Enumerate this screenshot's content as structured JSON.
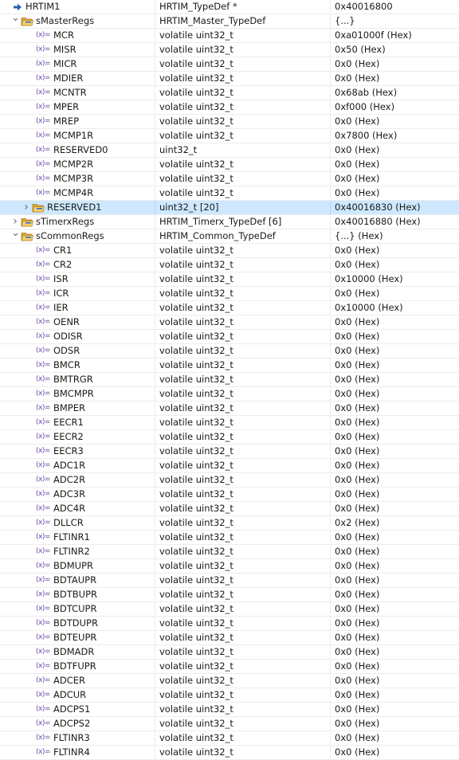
{
  "rows": [
    {
      "level": 0,
      "expander": "none",
      "icon": "pointer",
      "name": "HRTIM1",
      "type": "HRTIM_TypeDef *",
      "value": "0x40016800"
    },
    {
      "level": 1,
      "expander": "expanded",
      "icon": "struct",
      "name": "sMasterRegs",
      "type": "HRTIM_Master_TypeDef",
      "value": "{...}"
    },
    {
      "level": 2,
      "expander": "none",
      "icon": "variable",
      "name": "MCR",
      "type": "volatile uint32_t",
      "value": "0xa01000f (Hex)"
    },
    {
      "level": 2,
      "expander": "none",
      "icon": "variable",
      "name": "MISR",
      "type": "volatile uint32_t",
      "value": "0x50 (Hex)"
    },
    {
      "level": 2,
      "expander": "none",
      "icon": "variable",
      "name": "MICR",
      "type": "volatile uint32_t",
      "value": "0x0 (Hex)"
    },
    {
      "level": 2,
      "expander": "none",
      "icon": "variable",
      "name": "MDIER",
      "type": "volatile uint32_t",
      "value": "0x0 (Hex)"
    },
    {
      "level": 2,
      "expander": "none",
      "icon": "variable",
      "name": "MCNTR",
      "type": "volatile uint32_t",
      "value": "0x68ab (Hex)"
    },
    {
      "level": 2,
      "expander": "none",
      "icon": "variable",
      "name": "MPER",
      "type": "volatile uint32_t",
      "value": "0xf000 (Hex)"
    },
    {
      "level": 2,
      "expander": "none",
      "icon": "variable",
      "name": "MREP",
      "type": "volatile uint32_t",
      "value": "0x0 (Hex)"
    },
    {
      "level": 2,
      "expander": "none",
      "icon": "variable",
      "name": "MCMP1R",
      "type": "volatile uint32_t",
      "value": "0x7800 (Hex)"
    },
    {
      "level": 2,
      "expander": "none",
      "icon": "variable",
      "name": "RESERVED0",
      "type": "uint32_t",
      "value": "0x0 (Hex)"
    },
    {
      "level": 2,
      "expander": "none",
      "icon": "variable",
      "name": "MCMP2R",
      "type": "volatile uint32_t",
      "value": "0x0 (Hex)"
    },
    {
      "level": 2,
      "expander": "none",
      "icon": "variable",
      "name": "MCMP3R",
      "type": "volatile uint32_t",
      "value": "0x0 (Hex)"
    },
    {
      "level": 2,
      "expander": "none",
      "icon": "variable",
      "name": "MCMP4R",
      "type": "volatile uint32_t",
      "value": "0x0 (Hex)"
    },
    {
      "level": 2,
      "expander": "collapsed",
      "icon": "struct",
      "name": "RESERVED1",
      "type": "uint32_t [20]",
      "value": "0x40016830 (Hex)",
      "selected": true
    },
    {
      "level": 1,
      "expander": "collapsed",
      "icon": "struct",
      "name": "sTimerxRegs",
      "type": "HRTIM_Timerx_TypeDef [6]",
      "value": "0x40016880 (Hex)"
    },
    {
      "level": 1,
      "expander": "expanded",
      "icon": "struct",
      "name": "sCommonRegs",
      "type": "HRTIM_Common_TypeDef",
      "value": "{...} (Hex)"
    },
    {
      "level": 2,
      "expander": "none",
      "icon": "variable",
      "name": "CR1",
      "type": "volatile uint32_t",
      "value": "0x0 (Hex)"
    },
    {
      "level": 2,
      "expander": "none",
      "icon": "variable",
      "name": "CR2",
      "type": "volatile uint32_t",
      "value": "0x0 (Hex)"
    },
    {
      "level": 2,
      "expander": "none",
      "icon": "variable",
      "name": "ISR",
      "type": "volatile uint32_t",
      "value": "0x10000 (Hex)"
    },
    {
      "level": 2,
      "expander": "none",
      "icon": "variable",
      "name": "ICR",
      "type": "volatile uint32_t",
      "value": "0x0 (Hex)"
    },
    {
      "level": 2,
      "expander": "none",
      "icon": "variable",
      "name": "IER",
      "type": "volatile uint32_t",
      "value": "0x10000 (Hex)"
    },
    {
      "level": 2,
      "expander": "none",
      "icon": "variable",
      "name": "OENR",
      "type": "volatile uint32_t",
      "value": "0x0 (Hex)"
    },
    {
      "level": 2,
      "expander": "none",
      "icon": "variable",
      "name": "ODISR",
      "type": "volatile uint32_t",
      "value": "0x0 (Hex)"
    },
    {
      "level": 2,
      "expander": "none",
      "icon": "variable",
      "name": "ODSR",
      "type": "volatile uint32_t",
      "value": "0x0 (Hex)"
    },
    {
      "level": 2,
      "expander": "none",
      "icon": "variable",
      "name": "BMCR",
      "type": "volatile uint32_t",
      "value": "0x0 (Hex)"
    },
    {
      "level": 2,
      "expander": "none",
      "icon": "variable",
      "name": "BMTRGR",
      "type": "volatile uint32_t",
      "value": "0x0 (Hex)"
    },
    {
      "level": 2,
      "expander": "none",
      "icon": "variable",
      "name": "BMCMPR",
      "type": "volatile uint32_t",
      "value": "0x0 (Hex)"
    },
    {
      "level": 2,
      "expander": "none",
      "icon": "variable",
      "name": "BMPER",
      "type": "volatile uint32_t",
      "value": "0x0 (Hex)"
    },
    {
      "level": 2,
      "expander": "none",
      "icon": "variable",
      "name": "EECR1",
      "type": "volatile uint32_t",
      "value": "0x0 (Hex)"
    },
    {
      "level": 2,
      "expander": "none",
      "icon": "variable",
      "name": "EECR2",
      "type": "volatile uint32_t",
      "value": "0x0 (Hex)"
    },
    {
      "level": 2,
      "expander": "none",
      "icon": "variable",
      "name": "EECR3",
      "type": "volatile uint32_t",
      "value": "0x0 (Hex)"
    },
    {
      "level": 2,
      "expander": "none",
      "icon": "variable",
      "name": "ADC1R",
      "type": "volatile uint32_t",
      "value": "0x0 (Hex)"
    },
    {
      "level": 2,
      "expander": "none",
      "icon": "variable",
      "name": "ADC2R",
      "type": "volatile uint32_t",
      "value": "0x0 (Hex)"
    },
    {
      "level": 2,
      "expander": "none",
      "icon": "variable",
      "name": "ADC3R",
      "type": "volatile uint32_t",
      "value": "0x0 (Hex)"
    },
    {
      "level": 2,
      "expander": "none",
      "icon": "variable",
      "name": "ADC4R",
      "type": "volatile uint32_t",
      "value": "0x0 (Hex)"
    },
    {
      "level": 2,
      "expander": "none",
      "icon": "variable",
      "name": "DLLCR",
      "type": "volatile uint32_t",
      "value": "0x2 (Hex)"
    },
    {
      "level": 2,
      "expander": "none",
      "icon": "variable",
      "name": "FLTINR1",
      "type": "volatile uint32_t",
      "value": "0x0 (Hex)"
    },
    {
      "level": 2,
      "expander": "none",
      "icon": "variable",
      "name": "FLTINR2",
      "type": "volatile uint32_t",
      "value": "0x0 (Hex)"
    },
    {
      "level": 2,
      "expander": "none",
      "icon": "variable",
      "name": "BDMUPR",
      "type": "volatile uint32_t",
      "value": "0x0 (Hex)"
    },
    {
      "level": 2,
      "expander": "none",
      "icon": "variable",
      "name": "BDTAUPR",
      "type": "volatile uint32_t",
      "value": "0x0 (Hex)"
    },
    {
      "level": 2,
      "expander": "none",
      "icon": "variable",
      "name": "BDTBUPR",
      "type": "volatile uint32_t",
      "value": "0x0 (Hex)"
    },
    {
      "level": 2,
      "expander": "none",
      "icon": "variable",
      "name": "BDTCUPR",
      "type": "volatile uint32_t",
      "value": "0x0 (Hex)"
    },
    {
      "level": 2,
      "expander": "none",
      "icon": "variable",
      "name": "BDTDUPR",
      "type": "volatile uint32_t",
      "value": "0x0 (Hex)"
    },
    {
      "level": 2,
      "expander": "none",
      "icon": "variable",
      "name": "BDTEUPR",
      "type": "volatile uint32_t",
      "value": "0x0 (Hex)"
    },
    {
      "level": 2,
      "expander": "none",
      "icon": "variable",
      "name": "BDMADR",
      "type": "volatile uint32_t",
      "value": "0x0 (Hex)"
    },
    {
      "level": 2,
      "expander": "none",
      "icon": "variable",
      "name": "BDTFUPR",
      "type": "volatile uint32_t",
      "value": "0x0 (Hex)"
    },
    {
      "level": 2,
      "expander": "none",
      "icon": "variable",
      "name": "ADCER",
      "type": "volatile uint32_t",
      "value": "0x0 (Hex)"
    },
    {
      "level": 2,
      "expander": "none",
      "icon": "variable",
      "name": "ADCUR",
      "type": "volatile uint32_t",
      "value": "0x0 (Hex)"
    },
    {
      "level": 2,
      "expander": "none",
      "icon": "variable",
      "name": "ADCPS1",
      "type": "volatile uint32_t",
      "value": "0x0 (Hex)"
    },
    {
      "level": 2,
      "expander": "none",
      "icon": "variable",
      "name": "ADCPS2",
      "type": "volatile uint32_t",
      "value": "0x0 (Hex)"
    },
    {
      "level": 2,
      "expander": "none",
      "icon": "variable",
      "name": "FLTINR3",
      "type": "volatile uint32_t",
      "value": "0x0 (Hex)"
    },
    {
      "level": 2,
      "expander": "none",
      "icon": "variable",
      "name": "FLTINR4",
      "type": "volatile uint32_t",
      "value": "0x0 (Hex)"
    }
  ],
  "icons": {
    "variable_glyph": "(x)=",
    "variable_color": "#6a4aa8",
    "struct_color": "#e8b84a",
    "pointer_color": "#2f5fb3",
    "selection_color": "#cde8ff"
  }
}
